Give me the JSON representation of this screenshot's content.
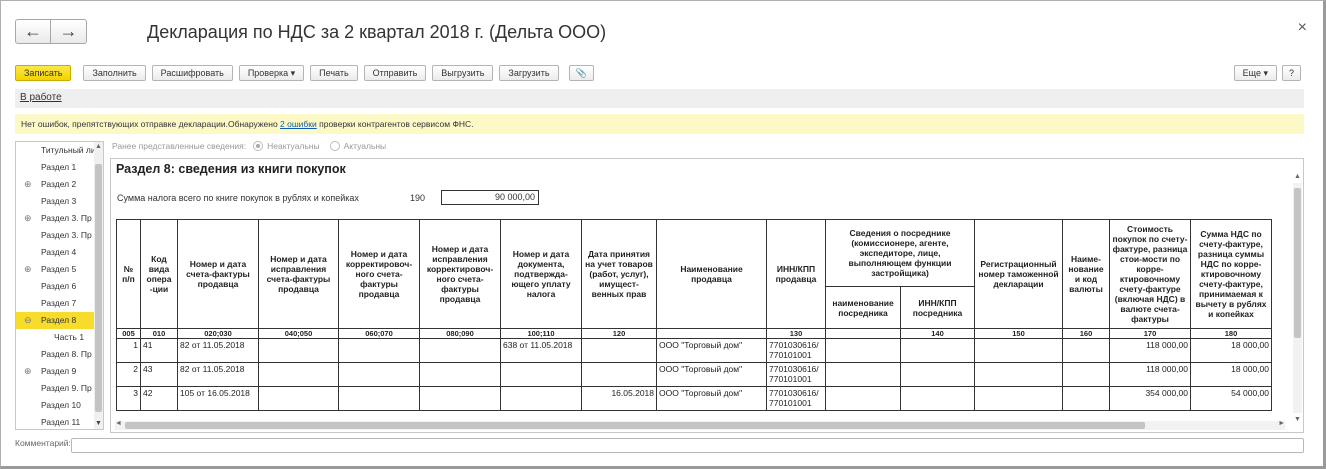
{
  "window": {
    "title": "Декларация по НДС за 2 квартал 2018 г. (Дельта ООО)",
    "back_icon": "←",
    "forward_icon": "→",
    "close_icon": "×"
  },
  "toolbar": {
    "save": "Записать",
    "fill": "Заполнить",
    "decode": "Расшифровать",
    "check": "Проверка ▾",
    "print": "Печать",
    "send": "Отправить",
    "upload": "Выгрузить",
    "download": "Загрузить",
    "attach_icon": "📎",
    "more": "Еще ▾",
    "help": "?"
  },
  "status": {
    "link": "В работе"
  },
  "notice": {
    "text_before": "Нет ошибок, препятствующих отправке декларации.Обнаружено ",
    "link": "2 ошибки",
    "text_after": " проверки контрагентов сервисом ФНС."
  },
  "sidebar": {
    "items": [
      {
        "label": "Титульный ли",
        "expand": "",
        "child": false,
        "active": false
      },
      {
        "label": "Раздел 1",
        "expand": "",
        "child": false,
        "active": false
      },
      {
        "label": "Раздел 2",
        "expand": "⊕",
        "child": false,
        "active": false
      },
      {
        "label": "Раздел 3",
        "expand": "",
        "child": false,
        "active": false
      },
      {
        "label": "Раздел 3. Пр",
        "expand": "⊕",
        "child": false,
        "active": false
      },
      {
        "label": "Раздел 3. Пр",
        "expand": "",
        "child": false,
        "active": false
      },
      {
        "label": "Раздел 4",
        "expand": "",
        "child": false,
        "active": false
      },
      {
        "label": "Раздел 5",
        "expand": "⊕",
        "child": false,
        "active": false
      },
      {
        "label": "Раздел 6",
        "expand": "",
        "child": false,
        "active": false
      },
      {
        "label": "Раздел 7",
        "expand": "",
        "child": false,
        "active": false
      },
      {
        "label": "Раздел 8",
        "expand": "⊖",
        "child": false,
        "active": true
      },
      {
        "label": "Часть 1",
        "expand": "",
        "child": true,
        "active": false
      },
      {
        "label": "Раздел 8. Пр",
        "expand": "",
        "child": false,
        "active": false
      },
      {
        "label": "Раздел 9",
        "expand": "⊕",
        "child": false,
        "active": false
      },
      {
        "label": "Раздел 9. Пр",
        "expand": "",
        "child": false,
        "active": false
      },
      {
        "label": "Раздел 10",
        "expand": "",
        "child": false,
        "active": false
      },
      {
        "label": "Раздел 11",
        "expand": "",
        "child": false,
        "active": false
      }
    ]
  },
  "prev_info": {
    "label": "Ранее представленные сведения:",
    "option1": "Неактуальны",
    "option2": "Актуальны"
  },
  "section": {
    "title": "Раздел 8: сведения из книги покупок",
    "sum_label": "Сумма налога всего по книге покупок в рублях и копейках",
    "sum_code": "190",
    "sum_value": "90 000,00"
  },
  "table": {
    "headers": {
      "num": "№ п/п",
      "op_code": "Код вида опера -ции",
      "inv": "Номер и дата счета-фактуры продавца",
      "inv_fix": "Номер и дата исправления счета-фактуры продавца",
      "corr": "Номер и дата корректировоч-ного счета-фактуры продавца",
      "corr_fix": "Номер и дата исправления корректировоч-ного счета-фактуры продавца",
      "pay_doc": "Номер и дата документа, подтвержда-ющего уплату налога",
      "accept_date": "Дата принятия на учет товаров (работ, услуг), имущест-венных прав",
      "seller": "Наименование продавца",
      "seller_inn": "ИНН/КПП продавца",
      "agent_group": "Сведения о посреднике (комиссионере, агенте, экспедиторе, лице, выполняющем функции застройщика)",
      "agent_name": "наименование посредника",
      "agent_inn": "ИНН/КПП посредника",
      "customs": "Регистрационный номер таможенной декларации",
      "currency": "Наиме-нование и код валюты",
      "cost": "Стоимость покупок по счету-фактуре, разница стои-мости по корре-ктировочному счету-фактуре (включая НДС) в валюте счета-фактуры",
      "vat": "Сумма НДС по счету-фактуре, разница суммы НДС по корре-ктировочному счету-фактуре, принимаемая к вычету в рублях и копейках"
    },
    "codes": [
      "005",
      "010",
      "020;030",
      "040;050",
      "060;070",
      "080;090",
      "100;110",
      "120",
      "",
      "130",
      "",
      "140",
      "150",
      "160",
      "170",
      "180"
    ],
    "rows": [
      {
        "num": "1",
        "op": "41",
        "inv": "82 от 11.05.2018",
        "inv_fix": "",
        "corr": "",
        "corr_fix": "",
        "pay": "638 от 11.05.2018",
        "date": "",
        "seller": "ООО \"Торговый дом\"",
        "inn": "7701030616/ 770101001",
        "agent_name": "",
        "agent_inn": "",
        "customs": "",
        "cur": "",
        "cost": "118 000,00",
        "vat": "18 000,00"
      },
      {
        "num": "2",
        "op": "43",
        "inv": "82 от 11.05.2018",
        "inv_fix": "",
        "corr": "",
        "corr_fix": "",
        "pay": "",
        "date": "",
        "seller": "ООО \"Торговый дом\"",
        "inn": "7701030616/ 770101001",
        "agent_name": "",
        "agent_inn": "",
        "customs": "",
        "cur": "",
        "cost": "118 000,00",
        "vat": "18 000,00"
      },
      {
        "num": "3",
        "op": "42",
        "inv": "105 от 16.05.2018",
        "inv_fix": "",
        "corr": "",
        "corr_fix": "",
        "pay": "",
        "date": "16.05.2018",
        "seller": "ООО \"Торговый дом\"",
        "inn": "7701030616/ 770101001",
        "agent_name": "",
        "agent_inn": "",
        "customs": "",
        "cur": "",
        "cost": "354 000,00",
        "vat": "54 000,00"
      }
    ]
  },
  "comment": {
    "label": "Комментарий:",
    "value": ""
  }
}
